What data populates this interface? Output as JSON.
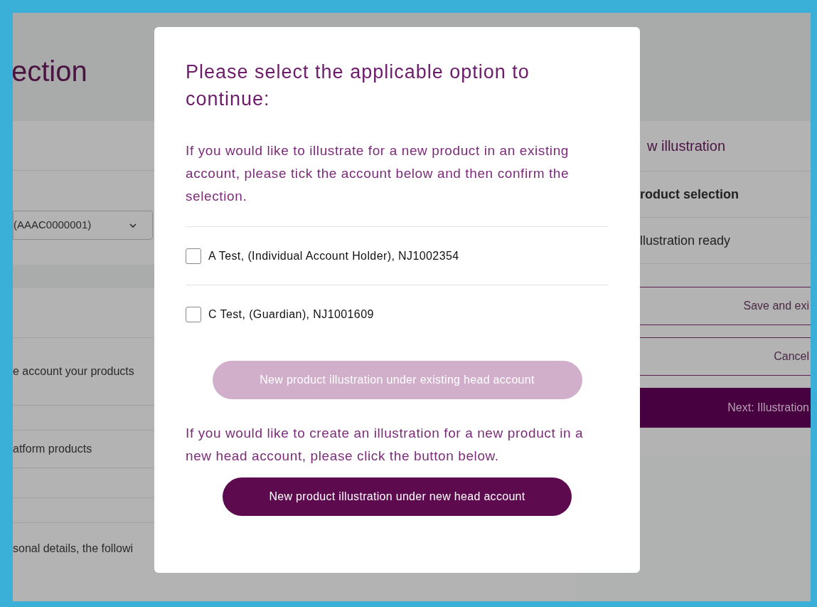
{
  "background": {
    "title": "ection",
    "account_select": {
      "value": "(AAAC0000001)"
    },
    "section_texts": [
      "e account your products",
      "atform products",
      "sonal details, the followi"
    ],
    "progress": {
      "title": "w illustration",
      "steps": [
        {
          "label": "roduct selection",
          "selected": true
        },
        {
          "label": "llustration ready",
          "selected": false
        }
      ]
    },
    "buttons": [
      {
        "label": "Save and exi",
        "kind": "outline"
      },
      {
        "label": "Cancel",
        "kind": "outline"
      },
      {
        "label": "Next: Illustration",
        "kind": "primary"
      }
    ]
  },
  "modal": {
    "title": "Please select the applicable option to continue:",
    "intro": "If you would like to illustrate for a new product in an existing account, please tick the account below and then confirm the selection.",
    "accounts": [
      {
        "label": "A Test, (Individual Account Holder), NJ1002354",
        "checked": false
      },
      {
        "label": "C Test, (Guardian), NJ1001609",
        "checked": false
      }
    ],
    "existing_button": {
      "label": "New product illustration under existing head account",
      "disabled": true
    },
    "new_text": "If you would like to create an illustration for a new product in a new head account, please click the button below.",
    "new_button": {
      "label": "New product illustration under new head account",
      "disabled": false
    }
  }
}
